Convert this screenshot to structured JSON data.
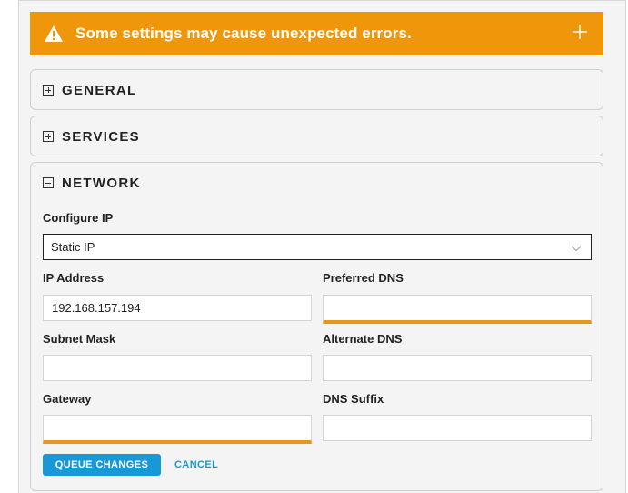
{
  "warning": {
    "text": "Some settings may cause unexpected errors.",
    "icon": "warning-triangle-icon",
    "expand_icon": "plus-icon"
  },
  "sections": {
    "general": {
      "title": "GENERAL",
      "state": "collapsed"
    },
    "services": {
      "title": "SERVICES",
      "state": "collapsed"
    },
    "network": {
      "title": "NETWORK",
      "state": "expanded"
    }
  },
  "network": {
    "configure_ip_label": "Configure IP",
    "configure_ip_value": "Static IP",
    "ip_address_label": "IP Address",
    "ip_address_value": "192.168.157.194",
    "preferred_dns_label": "Preferred DNS",
    "preferred_dns_value": "",
    "subnet_mask_label": "Subnet Mask",
    "subnet_mask_value": "",
    "alternate_dns_label": "Alternate DNS",
    "alternate_dns_value": "",
    "gateway_label": "Gateway",
    "gateway_value": "",
    "dns_suffix_label": "DNS Suffix",
    "dns_suffix_value": ""
  },
  "actions": {
    "queue_label": "QUEUE CHANGES",
    "cancel_label": "CANCEL"
  },
  "colors": {
    "warning_bg": "#f0960a",
    "accent_blue": "#1899d6",
    "active_underline": "#e8961e"
  }
}
